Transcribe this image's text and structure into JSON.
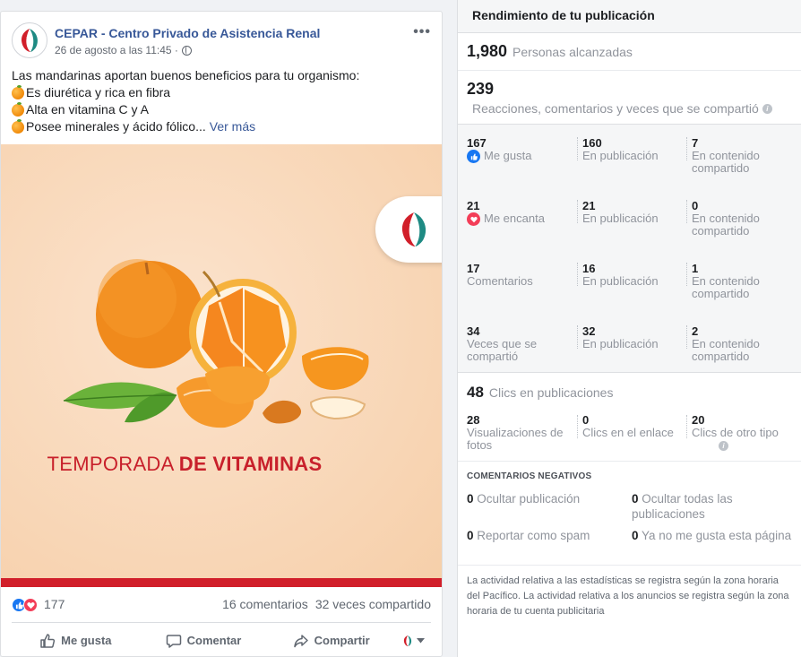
{
  "post": {
    "page_name": "CEPAR - Centro Privado de Asistencia Renal",
    "date": "26 de agosto a las 11:45 ·",
    "more_icon": "ellipsis-icon",
    "intro": "Las mandarinas aportan buenos beneficios para tu organismo:",
    "bullets": [
      "Es diurética y rica en fibra",
      "Alta en vitamina C y A",
      "Posee minerales y ácido fólico..."
    ],
    "see_more": "Ver más",
    "image": {
      "caption_regular": "TEMPORADA",
      "caption_bold": "DE VITAMINAS",
      "strip_color": "#d11f2a"
    },
    "reactions_count": "177",
    "comments_count": "16 comentarios",
    "shares_count": "32 veces compartido",
    "actions": {
      "like": "Me gusta",
      "comment": "Comentar",
      "share": "Compartir"
    }
  },
  "insights": {
    "title": "Rendimiento de tu publicación",
    "reach": {
      "value": "1,980",
      "label": "Personas alcanzadas"
    },
    "engagement": {
      "value": "239",
      "label": "Reacciones, comentarios y veces que se compartió"
    },
    "rows": [
      {
        "total": "167",
        "label": "Me gusta",
        "icon": "like",
        "on_post": "160",
        "on_post_label": "En publicación",
        "shared": "7",
        "shared_label": "En contenido compartido"
      },
      {
        "total": "21",
        "label": "Me encanta",
        "icon": "love",
        "on_post": "21",
        "on_post_label": "En publicación",
        "shared": "0",
        "shared_label": "En contenido compartido"
      },
      {
        "total": "17",
        "label": "Comentarios",
        "icon": "",
        "on_post": "16",
        "on_post_label": "En publicación",
        "shared": "1",
        "shared_label": "En contenido compartido"
      },
      {
        "total": "34",
        "label": "Veces que se compartió",
        "icon": "",
        "on_post": "32",
        "on_post_label": "En publicación",
        "shared": "2",
        "shared_label": "En contenido compartido"
      }
    ],
    "clicks": {
      "value": "48",
      "label": "Clics en publicaciones",
      "photo_views": {
        "value": "28",
        "label": "Visualizaciones de fotos"
      },
      "link_clicks": {
        "value": "0",
        "label": "Clics en el enlace"
      },
      "other_clicks": {
        "value": "20",
        "label": "Clics de otro tipo"
      }
    },
    "negative": {
      "title": "COMENTARIOS NEGATIVOS",
      "hide_post": {
        "value": "0",
        "label": "Ocultar publicación"
      },
      "hide_all": {
        "value": "0",
        "label": "Ocultar todas las publicaciones"
      },
      "spam": {
        "value": "0",
        "label": "Reportar como spam"
      },
      "unlike": {
        "value": "0",
        "label": "Ya no me gusta esta página"
      }
    },
    "footnote": "La actividad relativa a las estadísticas se registra según la zona horaria del Pacífico. La actividad relativa a los anuncios se registra según la zona horaria de tu cuenta publicitaria"
  },
  "colors": {
    "link": "#385898",
    "like_blue": "#1877f2",
    "love_red": "#f33e58",
    "brand_red": "#c8202b"
  }
}
